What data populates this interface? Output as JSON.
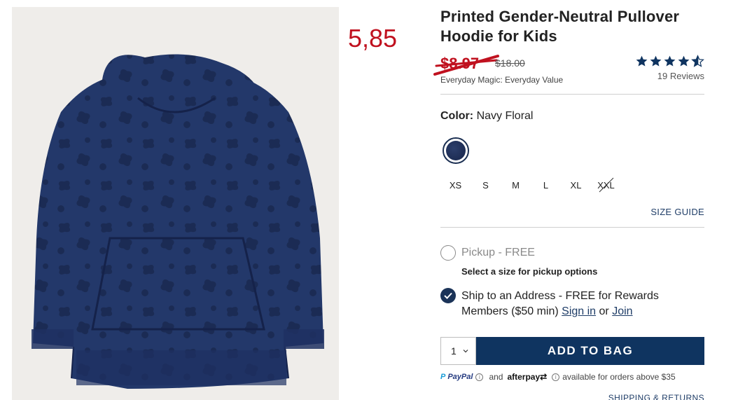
{
  "overlay_price": "5,85",
  "product": {
    "title": "Printed Gender-Neutral Pullover Hoodie for Kids",
    "sale_price": "$8.97",
    "original_price": "$18.00",
    "value_text": "Everyday Magic: Everyday Value",
    "rating": 4.5,
    "reviews": "19 Reviews"
  },
  "color": {
    "label": "Color:",
    "value": "Navy Floral"
  },
  "sizes": [
    {
      "label": "XS",
      "available": true
    },
    {
      "label": "S",
      "available": true
    },
    {
      "label": "M",
      "available": true
    },
    {
      "label": "L",
      "available": true
    },
    {
      "label": "XL",
      "available": true
    },
    {
      "label": "XXL",
      "available": false
    }
  ],
  "size_guide": "SIZE GUIDE",
  "fulfillment": {
    "pickup_label": "Pickup - FREE",
    "pickup_note": "Select a size for pickup options",
    "ship_label": "Ship to an Address - FREE for Rewards Members ($50 min)",
    "sign_in": "Sign in",
    "or_text": "or",
    "join": "Join"
  },
  "cart": {
    "quantity": "1",
    "add_to_bag": "ADD TO BAG"
  },
  "payments": {
    "paypal": "PayPal",
    "and_text": "and",
    "afterpay": "afterpay",
    "note": "available for orders above $35"
  },
  "shipping_returns": "SHIPPING & RETURNS",
  "colors": {
    "sale": "#c0111f",
    "navy": "#0f3460",
    "link": "#1f3d67",
    "hoodie": "#23386a"
  }
}
